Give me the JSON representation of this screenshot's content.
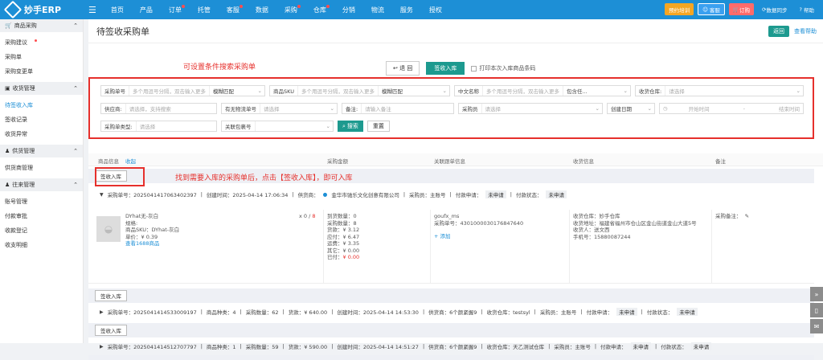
{
  "topnav": {
    "brand": "妙手ERP",
    "items": [
      {
        "label": "首页",
        "dot": false
      },
      {
        "label": "产品",
        "dot": false
      },
      {
        "label": "订单",
        "dot": true
      },
      {
        "label": "托管",
        "dot": false
      },
      {
        "label": "客服",
        "dot": true
      },
      {
        "label": "数据",
        "dot": false
      },
      {
        "label": "采购",
        "dot": true
      },
      {
        "label": "仓库",
        "dot": true
      },
      {
        "label": "分销",
        "dot": false
      },
      {
        "label": "物流",
        "dot": false
      },
      {
        "label": "服务",
        "dot": false
      },
      {
        "label": "授权",
        "dot": false
      }
    ],
    "right": {
      "appointment": "预约培训",
      "service": "客服",
      "order": "订购",
      "sync": "数据同步",
      "help": "帮助"
    }
  },
  "sidebar": {
    "groups": [
      {
        "title": "商品采购",
        "items": [
          {
            "label": "采购建议",
            "dot": true,
            "active": false
          },
          {
            "label": "采购单",
            "dot": false,
            "active": false
          },
          {
            "label": "采购变更单",
            "dot": false,
            "active": false
          }
        ]
      },
      {
        "title": "收货管理",
        "items": [
          {
            "label": "待签收入库",
            "dot": false,
            "active": true
          },
          {
            "label": "签收记录",
            "dot": false,
            "active": false
          },
          {
            "label": "收货异常",
            "dot": false,
            "active": false
          }
        ]
      },
      {
        "title": "供货管理",
        "items": [
          {
            "label": "供货商管理",
            "dot": false,
            "active": false
          }
        ]
      },
      {
        "title": "往来管理",
        "items": [
          {
            "label": "账号管理",
            "dot": false,
            "active": false
          },
          {
            "label": "付款审批",
            "dot": false,
            "active": false
          },
          {
            "label": "收款登记",
            "dot": false,
            "active": false
          },
          {
            "label": "收支明细",
            "dot": false,
            "active": false
          }
        ]
      }
    ]
  },
  "page": {
    "title": "待签收采购单",
    "back": "返回",
    "help": "查看帮助",
    "annot_search": "可设置条件搜索采购单",
    "annot_row": "找到需要入库的采购单后，点击【签收入库】，即可入库"
  },
  "toolbar": {
    "return": "退 回",
    "receive": "签收入库",
    "print": "打印本次入库商品条码"
  },
  "filters": {
    "row1": [
      {
        "label": "采购单号",
        "ph": "多个用逗号分隔，双击输入更多",
        "extra": "模糊匹配"
      },
      {
        "label": "商品SKU",
        "ph": "多个用逗号分隔，双击输入更多",
        "extra": "模糊匹配"
      },
      {
        "label": "中文名称",
        "ph": "多个用逗号分隔，双击输入更多",
        "extra": "包含任..."
      },
      {
        "label": "收货仓库:",
        "ph": "请选择",
        "extra": ""
      }
    ],
    "row2": [
      {
        "label": "供应商:",
        "ph": "请选择，支持搜索"
      },
      {
        "label": "有无物流单号",
        "ph": "请选择"
      },
      {
        "label": "备注:",
        "ph": "请输入备注"
      },
      {
        "label": "采购员",
        "ph": "请选择"
      },
      {
        "label": "创建日期",
        "ph": ""
      },
      {
        "label": "开始时间",
        "ph": "结束时间"
      }
    ],
    "row3": [
      {
        "label": "采购单类型:",
        "ph": "请选择"
      },
      {
        "label": "关联包裹号",
        "ph": ""
      }
    ],
    "search": "搜索",
    "reset": "重置"
  },
  "table": {
    "headers": [
      "商品信息",
      "收起",
      "采购金额",
      "关联跟单信息",
      "收货信息",
      "备注"
    ],
    "receive_btn": "签收入库",
    "orders": [
      {
        "no": "采购单号：2025041417063402397",
        "created": "创建时间：2025-04-14 17:06:34",
        "supplier": "供货商：",
        "supplier_name": "金华市驰乐文化创意有限公司",
        "buyer": "采购员：主账号",
        "pay_req": "付款申请：",
        "pay_req_v": "未申请",
        "pay_st": "付款状态：",
        "pay_st_v": "未申请"
      },
      {
        "no": "采购单号：2025041414533009197",
        "kinds": "商品种类：4",
        "qty": "采购数量：62",
        "amount": "货款：¥ 640.00",
        "created": "创建时间：2025-04-14 14:53:30",
        "supplier": "供货商：6个颜紧握9",
        "wh": "收货仓库：testsyl",
        "buyer": "采购员：主账号",
        "pay_req": "付款申请：",
        "pay_req_v": "未申请",
        "pay_st": "付款状态：",
        "pay_st_v": "未申请"
      },
      {
        "no": "采购单号：2025041414512707797",
        "kinds": "商品种类：1",
        "qty": "采购数量：59",
        "amount": "货款：¥ 590.00",
        "created": "创建时间：2025-04-14 14:51:27",
        "supplier": "供货商：6个颜紧握9",
        "wh": "收货仓库：天乙测试仓库",
        "buyer": "采购员：主账号",
        "pay_req": "付款申请：",
        "pay_req_v": "未申请",
        "pay_st": "付款状态：",
        "pay_st_v": "未申请"
      }
    ],
    "item": {
      "name": "DYhat无-灰白",
      "attr": "规格:",
      "sku": "商品SKU：DYhat-灰白",
      "price": "单价：¥ 0.39",
      "link": "查看1688商品",
      "count_label": "x 0 /",
      "count_red": "8",
      "arrived": "到货数量：0",
      "bought": "采购数量：8",
      "goods": "货款：¥ 3.12",
      "paid": "应付：¥ 6.47",
      "freight": "运费：¥ 3.35",
      "other": "其它：¥ 0.00",
      "paid_done": "已付：",
      "paid_done_v": "¥ 0.00",
      "track_id": "goufx_ms",
      "track_no": "采购单号：4301000030176847640",
      "add": "+ 添加",
      "recv_wh": "收货仓库：妙手仓库",
      "recv_addr": "收货地址：福建省福州市仓山区金山街道金山大道5号",
      "recv_person": "收货人：送文西",
      "phone": "手机号：15880087244",
      "remark": "采购备注："
    }
  }
}
